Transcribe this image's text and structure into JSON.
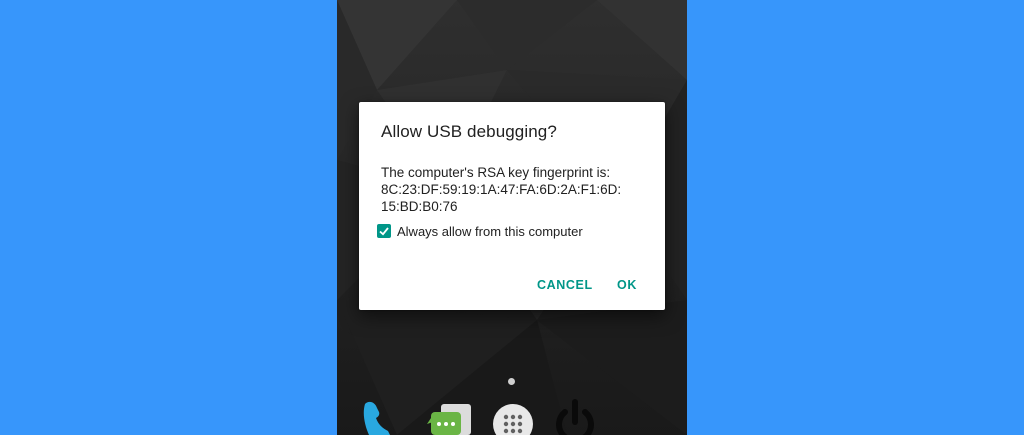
{
  "dialog": {
    "title": "Allow USB debugging?",
    "fingerprint_intro": "The computer's RSA key fingerprint is:",
    "fingerprint_line1": "8C:23:DF:59:19:1A:47:FA:6D:2A:F1:6D:",
    "fingerprint_line2": "15:BD:B0:76",
    "checkbox_label": "Always allow from this computer",
    "checkbox_checked": true,
    "cancel_label": "CANCEL",
    "ok_label": "OK",
    "accent_color": "#009688"
  },
  "background_color": "#3796fb",
  "dock": {
    "icons": [
      "phone-icon",
      "messaging-icon",
      "app-drawer-icon",
      "power-icon"
    ]
  }
}
